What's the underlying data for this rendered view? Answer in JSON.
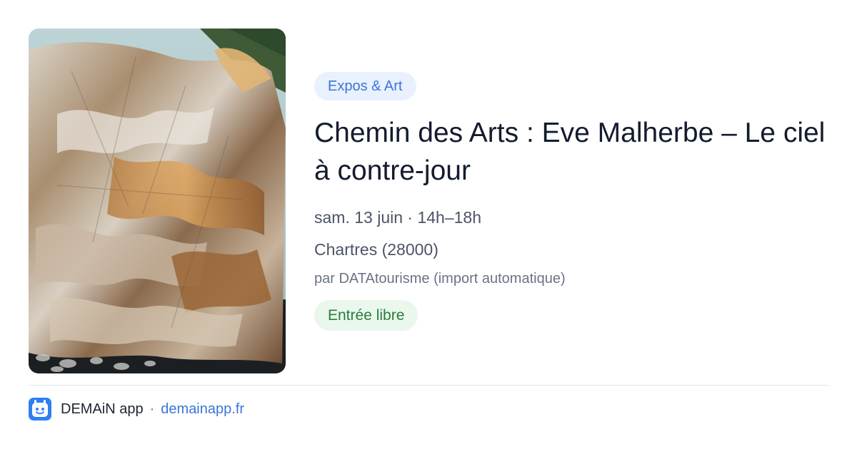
{
  "event": {
    "category": "Expos & Art",
    "title": "Chemin des Arts : Eve Malherbe – Le ciel à contre-jour",
    "date": "sam. 13 juin · 14h–18h",
    "location": "Chartres (28000)",
    "source": "par DATAtourisme (import automatique)",
    "price": "Entrée libre",
    "image_icon": "crumpled-gold-foil-painting"
  },
  "footer": {
    "app_name": "DEMAiN app",
    "separator": "·",
    "link": "demainapp.fr",
    "logo_icon": "demain-app-logo-icon"
  },
  "colors": {
    "accent_blue": "#3a76d6",
    "category_bg": "#e9f1fe",
    "price_green": "#2a7d3e",
    "price_bg": "#e9f7ec",
    "title": "#131c2e",
    "meta": "#4b5465"
  }
}
